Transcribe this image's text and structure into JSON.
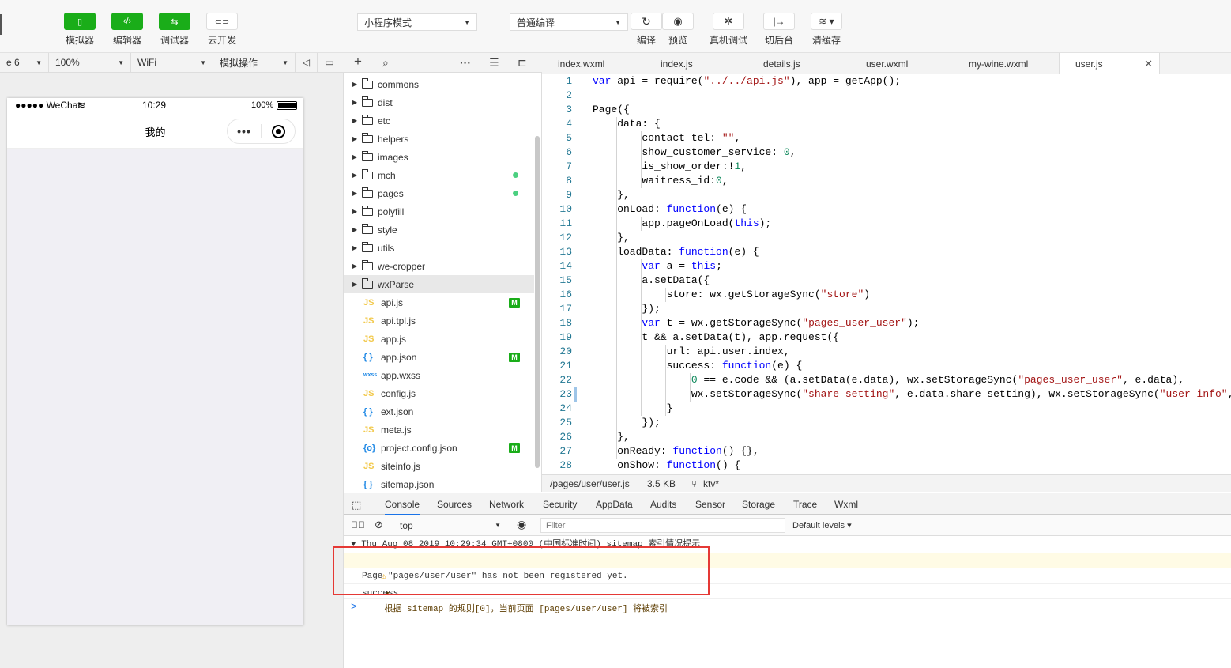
{
  "toolbar": {
    "buttons_left": [
      {
        "label": "模拟器",
        "icon": "phone-icon"
      },
      {
        "label": "编辑器",
        "icon": "code-icon"
      },
      {
        "label": "调试器",
        "icon": "debug-icon"
      },
      {
        "label": "云开发",
        "icon": "cloud-icon"
      }
    ],
    "mode_select": "小程序模式",
    "compile_select": "普通编译",
    "buttons_right": [
      {
        "label": "编译",
        "icon": "refresh-icon"
      },
      {
        "label": "预览",
        "icon": "eye-icon"
      },
      {
        "label": "真机调试",
        "icon": "bug-icon"
      },
      {
        "label": "切后台",
        "icon": "switch-icon"
      },
      {
        "label": "清缓存",
        "icon": "layers-icon"
      }
    ]
  },
  "sim_bar": {
    "device": "e 6",
    "zoom": "100%",
    "network": "WiFi",
    "operation": "模拟操作"
  },
  "phone": {
    "carrier": "●●●●● WeChat",
    "time": "10:29",
    "battery": "100%",
    "title": "我的"
  },
  "tree": {
    "items": [
      {
        "name": "commons",
        "type": "folder",
        "marker": ""
      },
      {
        "name": "dist",
        "type": "folder",
        "marker": ""
      },
      {
        "name": "etc",
        "type": "folder",
        "marker": ""
      },
      {
        "name": "helpers",
        "type": "folder",
        "marker": ""
      },
      {
        "name": "images",
        "type": "folder",
        "marker": ""
      },
      {
        "name": "mch",
        "type": "folder",
        "marker": "dot"
      },
      {
        "name": "pages",
        "type": "folder",
        "marker": "dot"
      },
      {
        "name": "polyfill",
        "type": "folder",
        "marker": ""
      },
      {
        "name": "style",
        "type": "folder",
        "marker": ""
      },
      {
        "name": "utils",
        "type": "folder",
        "marker": ""
      },
      {
        "name": "we-cropper",
        "type": "folder",
        "marker": ""
      },
      {
        "name": "wxParse",
        "type": "folder",
        "marker": "",
        "selected": true
      },
      {
        "name": "api.js",
        "type": "js",
        "marker": "M"
      },
      {
        "name": "api.tpl.js",
        "type": "js",
        "marker": ""
      },
      {
        "name": "app.js",
        "type": "js",
        "marker": ""
      },
      {
        "name": "app.json",
        "type": "json",
        "marker": "M"
      },
      {
        "name": "app.wxss",
        "type": "wxss",
        "marker": ""
      },
      {
        "name": "config.js",
        "type": "js",
        "marker": ""
      },
      {
        "name": "ext.json",
        "type": "json",
        "marker": ""
      },
      {
        "name": "meta.js",
        "type": "js",
        "marker": ""
      },
      {
        "name": "project.config.json",
        "type": "config",
        "marker": "M"
      },
      {
        "name": "siteinfo.js",
        "type": "js",
        "marker": ""
      },
      {
        "name": "sitemap.json",
        "type": "json",
        "marker": ""
      }
    ],
    "icon_labels": {
      "js": "JS",
      "json": "{ }",
      "wxss": "wxss",
      "config": "{o}"
    }
  },
  "tabs": [
    {
      "label": "index.wxml"
    },
    {
      "label": "index.js"
    },
    {
      "label": "details.js"
    },
    {
      "label": "user.wxml"
    },
    {
      "label": "my-wine.wxml"
    },
    {
      "label": "user.js",
      "active": true
    }
  ],
  "code": [
    {
      "n": "1",
      "t": "var api = require(\"../../api.js\"), app = getApp();"
    },
    {
      "n": "2",
      "t": ""
    },
    {
      "n": "3",
      "t": "Page({"
    },
    {
      "n": "4",
      "t": "    data: {"
    },
    {
      "n": "5",
      "t": "        contact_tel: \"\","
    },
    {
      "n": "6",
      "t": "        show_customer_service: 0,"
    },
    {
      "n": "7",
      "t": "        is_show_order:!1,"
    },
    {
      "n": "8",
      "t": "        waitress_id:0,"
    },
    {
      "n": "9",
      "t": "    },"
    },
    {
      "n": "10",
      "t": "    onLoad: function(e) {"
    },
    {
      "n": "11",
      "t": "        app.pageOnLoad(this);"
    },
    {
      "n": "12",
      "t": "    },"
    },
    {
      "n": "13",
      "t": "    loadData: function(e) {"
    },
    {
      "n": "14",
      "t": "        var a = this;"
    },
    {
      "n": "15",
      "t": "        a.setData({"
    },
    {
      "n": "16",
      "t": "            store: wx.getStorageSync(\"store\")"
    },
    {
      "n": "17",
      "t": "        });"
    },
    {
      "n": "18",
      "t": "        var t = wx.getStorageSync(\"pages_user_user\");"
    },
    {
      "n": "19",
      "t": "        t && a.setData(t), app.request({"
    },
    {
      "n": "20",
      "t": "            url: api.user.index,"
    },
    {
      "n": "21",
      "t": "            success: function(e) {"
    },
    {
      "n": "22",
      "t": "                0 == e.code && (a.setData(e.data), wx.setStorageSync(\"pages_user_user\", e.data),"
    },
    {
      "n": "23",
      "t": "                wx.setStorageSync(\"share_setting\", e.data.share_setting), wx.setStorageSync(\"user_info\","
    },
    {
      "n": "24",
      "t": "            }"
    },
    {
      "n": "25",
      "t": "        });"
    },
    {
      "n": "26",
      "t": "    },"
    },
    {
      "n": "27",
      "t": "    onReady: function() {},"
    },
    {
      "n": "28",
      "t": "    onShow: function() {"
    }
  ],
  "editor_status": {
    "path": "/pages/user/user.js",
    "size": "3.5 KB",
    "branch": "ktv*"
  },
  "devtools": {
    "tabs": [
      "Console",
      "Sources",
      "Network",
      "Security",
      "AppData",
      "Audits",
      "Sensor",
      "Storage",
      "Trace",
      "Wxml"
    ],
    "context": "top",
    "filter_placeholder": "Filter",
    "levels": "Default levels ▾"
  },
  "console": {
    "group": "▼ Thu Aug 08 2019 10:29:34 GMT+0800 (中国标准时间) sitemap 索引情况提示",
    "warning": "根据 sitemap 的规则[0]，当前页面 [pages/user/user] 将被索引",
    "log1": "Page \"pages/user/user\" has not been registered yet.",
    "log2": "success",
    "prompt": ">"
  },
  "colors": {
    "accent_green": "#1aad19",
    "highlight_red": "#e53935",
    "keyword_blue": "#0000ff",
    "string_red": "#a31515"
  }
}
